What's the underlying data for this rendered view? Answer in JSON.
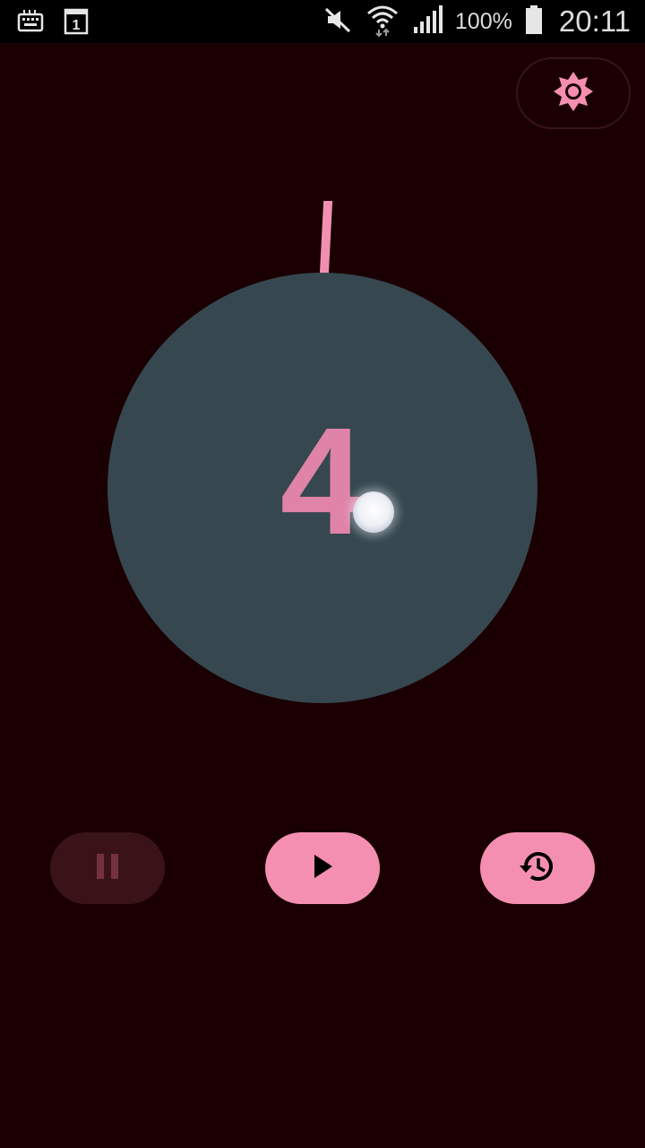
{
  "status_bar": {
    "battery_percent": "100%",
    "time": "20:11",
    "icons": [
      "keyboard-icon",
      "calendar-icon",
      "mute-icon",
      "wifi-icon",
      "signal-icon",
      "battery-icon"
    ]
  },
  "timer": {
    "count": "4"
  },
  "controls": {
    "settings_icon": "brightness-icon",
    "pause_icon": "pause-icon",
    "play_icon": "play-icon",
    "reset_icon": "restore-icon",
    "pause_enabled": false
  },
  "colors": {
    "background": "#1a0003",
    "accent": "#f48fb1",
    "dial": "#36474f"
  }
}
